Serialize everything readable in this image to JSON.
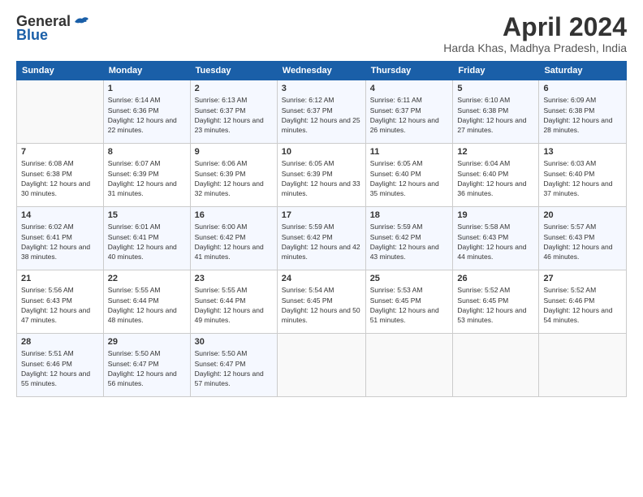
{
  "header": {
    "logo_general": "General",
    "logo_blue": "Blue",
    "title": "April 2024",
    "location": "Harda Khas, Madhya Pradesh, India"
  },
  "calendar": {
    "days_of_week": [
      "Sunday",
      "Monday",
      "Tuesday",
      "Wednesday",
      "Thursday",
      "Friday",
      "Saturday"
    ],
    "weeks": [
      [
        {
          "day": "",
          "sunrise": "",
          "sunset": "",
          "daylight": ""
        },
        {
          "day": "1",
          "sunrise": "Sunrise: 6:14 AM",
          "sunset": "Sunset: 6:36 PM",
          "daylight": "Daylight: 12 hours and 22 minutes."
        },
        {
          "day": "2",
          "sunrise": "Sunrise: 6:13 AM",
          "sunset": "Sunset: 6:37 PM",
          "daylight": "Daylight: 12 hours and 23 minutes."
        },
        {
          "day": "3",
          "sunrise": "Sunrise: 6:12 AM",
          "sunset": "Sunset: 6:37 PM",
          "daylight": "Daylight: 12 hours and 25 minutes."
        },
        {
          "day": "4",
          "sunrise": "Sunrise: 6:11 AM",
          "sunset": "Sunset: 6:37 PM",
          "daylight": "Daylight: 12 hours and 26 minutes."
        },
        {
          "day": "5",
          "sunrise": "Sunrise: 6:10 AM",
          "sunset": "Sunset: 6:38 PM",
          "daylight": "Daylight: 12 hours and 27 minutes."
        },
        {
          "day": "6",
          "sunrise": "Sunrise: 6:09 AM",
          "sunset": "Sunset: 6:38 PM",
          "daylight": "Daylight: 12 hours and 28 minutes."
        }
      ],
      [
        {
          "day": "7",
          "sunrise": "Sunrise: 6:08 AM",
          "sunset": "Sunset: 6:38 PM",
          "daylight": "Daylight: 12 hours and 30 minutes."
        },
        {
          "day": "8",
          "sunrise": "Sunrise: 6:07 AM",
          "sunset": "Sunset: 6:39 PM",
          "daylight": "Daylight: 12 hours and 31 minutes."
        },
        {
          "day": "9",
          "sunrise": "Sunrise: 6:06 AM",
          "sunset": "Sunset: 6:39 PM",
          "daylight": "Daylight: 12 hours and 32 minutes."
        },
        {
          "day": "10",
          "sunrise": "Sunrise: 6:05 AM",
          "sunset": "Sunset: 6:39 PM",
          "daylight": "Daylight: 12 hours and 33 minutes."
        },
        {
          "day": "11",
          "sunrise": "Sunrise: 6:05 AM",
          "sunset": "Sunset: 6:40 PM",
          "daylight": "Daylight: 12 hours and 35 minutes."
        },
        {
          "day": "12",
          "sunrise": "Sunrise: 6:04 AM",
          "sunset": "Sunset: 6:40 PM",
          "daylight": "Daylight: 12 hours and 36 minutes."
        },
        {
          "day": "13",
          "sunrise": "Sunrise: 6:03 AM",
          "sunset": "Sunset: 6:40 PM",
          "daylight": "Daylight: 12 hours and 37 minutes."
        }
      ],
      [
        {
          "day": "14",
          "sunrise": "Sunrise: 6:02 AM",
          "sunset": "Sunset: 6:41 PM",
          "daylight": "Daylight: 12 hours and 38 minutes."
        },
        {
          "day": "15",
          "sunrise": "Sunrise: 6:01 AM",
          "sunset": "Sunset: 6:41 PM",
          "daylight": "Daylight: 12 hours and 40 minutes."
        },
        {
          "day": "16",
          "sunrise": "Sunrise: 6:00 AM",
          "sunset": "Sunset: 6:42 PM",
          "daylight": "Daylight: 12 hours and 41 minutes."
        },
        {
          "day": "17",
          "sunrise": "Sunrise: 5:59 AM",
          "sunset": "Sunset: 6:42 PM",
          "daylight": "Daylight: 12 hours and 42 minutes."
        },
        {
          "day": "18",
          "sunrise": "Sunrise: 5:59 AM",
          "sunset": "Sunset: 6:42 PM",
          "daylight": "Daylight: 12 hours and 43 minutes."
        },
        {
          "day": "19",
          "sunrise": "Sunrise: 5:58 AM",
          "sunset": "Sunset: 6:43 PM",
          "daylight": "Daylight: 12 hours and 44 minutes."
        },
        {
          "day": "20",
          "sunrise": "Sunrise: 5:57 AM",
          "sunset": "Sunset: 6:43 PM",
          "daylight": "Daylight: 12 hours and 46 minutes."
        }
      ],
      [
        {
          "day": "21",
          "sunrise": "Sunrise: 5:56 AM",
          "sunset": "Sunset: 6:43 PM",
          "daylight": "Daylight: 12 hours and 47 minutes."
        },
        {
          "day": "22",
          "sunrise": "Sunrise: 5:55 AM",
          "sunset": "Sunset: 6:44 PM",
          "daylight": "Daylight: 12 hours and 48 minutes."
        },
        {
          "day": "23",
          "sunrise": "Sunrise: 5:55 AM",
          "sunset": "Sunset: 6:44 PM",
          "daylight": "Daylight: 12 hours and 49 minutes."
        },
        {
          "day": "24",
          "sunrise": "Sunrise: 5:54 AM",
          "sunset": "Sunset: 6:45 PM",
          "daylight": "Daylight: 12 hours and 50 minutes."
        },
        {
          "day": "25",
          "sunrise": "Sunrise: 5:53 AM",
          "sunset": "Sunset: 6:45 PM",
          "daylight": "Daylight: 12 hours and 51 minutes."
        },
        {
          "day": "26",
          "sunrise": "Sunrise: 5:52 AM",
          "sunset": "Sunset: 6:45 PM",
          "daylight": "Daylight: 12 hours and 53 minutes."
        },
        {
          "day": "27",
          "sunrise": "Sunrise: 5:52 AM",
          "sunset": "Sunset: 6:46 PM",
          "daylight": "Daylight: 12 hours and 54 minutes."
        }
      ],
      [
        {
          "day": "28",
          "sunrise": "Sunrise: 5:51 AM",
          "sunset": "Sunset: 6:46 PM",
          "daylight": "Daylight: 12 hours and 55 minutes."
        },
        {
          "day": "29",
          "sunrise": "Sunrise: 5:50 AM",
          "sunset": "Sunset: 6:47 PM",
          "daylight": "Daylight: 12 hours and 56 minutes."
        },
        {
          "day": "30",
          "sunrise": "Sunrise: 5:50 AM",
          "sunset": "Sunset: 6:47 PM",
          "daylight": "Daylight: 12 hours and 57 minutes."
        },
        {
          "day": "",
          "sunrise": "",
          "sunset": "",
          "daylight": ""
        },
        {
          "day": "",
          "sunrise": "",
          "sunset": "",
          "daylight": ""
        },
        {
          "day": "",
          "sunrise": "",
          "sunset": "",
          "daylight": ""
        },
        {
          "day": "",
          "sunrise": "",
          "sunset": "",
          "daylight": ""
        }
      ]
    ]
  }
}
